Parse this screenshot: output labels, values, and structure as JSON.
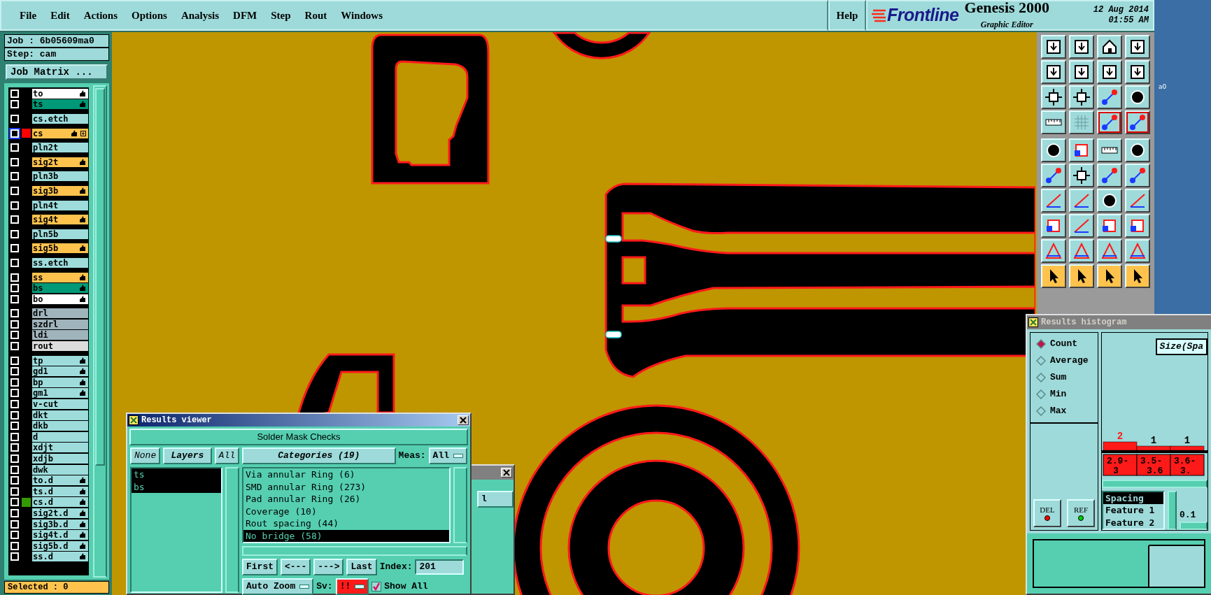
{
  "menubar": {
    "items": [
      {
        "label": "File"
      },
      {
        "label": "Edit"
      },
      {
        "label": "Actions"
      },
      {
        "label": "Options"
      },
      {
        "label": "Analysis"
      },
      {
        "label": "DFM"
      },
      {
        "label": "Step"
      },
      {
        "label": "Rout"
      },
      {
        "label": "Windows"
      }
    ],
    "help": "Help"
  },
  "branding": {
    "logo": "Frontline",
    "product": "Genesis 2000",
    "subtitle": "Graphic Editor",
    "date": "12 Aug 2014",
    "time": "01:55 AM"
  },
  "desktop": {
    "label": "a0"
  },
  "job_panel": {
    "job": "Job : 6b05609ma0",
    "step": "Step: cam",
    "matrix_button": "Job Matrix ...",
    "status": "Selected : 0",
    "layer_groups": [
      {
        "layers": [
          {
            "name": "to",
            "color": "#ffffff",
            "hand": true,
            "checked": false,
            "active": false
          },
          {
            "name": "ts",
            "color": "#009977",
            "hand": true,
            "checked": false,
            "active": false
          }
        ]
      },
      {
        "layers": [
          {
            "name": "cs.etch",
            "color": "#9edcdc",
            "hand": false,
            "checked": false,
            "active": false
          }
        ]
      },
      {
        "layers": [
          {
            "name": "cs",
            "color": "#ffc34d",
            "hand": true,
            "checked": false,
            "active": true,
            "swatch": {
              "color": "#ff0000"
            },
            "marker": true
          }
        ]
      },
      {
        "layers": [
          {
            "name": "pln2t",
            "color": "#9edcdc",
            "hand": false,
            "checked": false,
            "active": false
          }
        ]
      },
      {
        "layers": [
          {
            "name": "sig2t",
            "color": "#ffc34d",
            "hand": true,
            "checked": false,
            "active": false
          }
        ]
      },
      {
        "layers": [
          {
            "name": "pln3b",
            "color": "#9edcdc",
            "hand": false,
            "checked": false,
            "active": false
          }
        ]
      },
      {
        "layers": [
          {
            "name": "sig3b",
            "color": "#ffc34d",
            "hand": true,
            "checked": false,
            "active": false
          }
        ]
      },
      {
        "layers": [
          {
            "name": "pln4t",
            "color": "#9edcdc",
            "hand": false,
            "checked": false,
            "active": false
          }
        ]
      },
      {
        "layers": [
          {
            "name": "sig4t",
            "color": "#ffc34d",
            "hand": true,
            "checked": false,
            "active": false
          }
        ]
      },
      {
        "layers": [
          {
            "name": "pln5b",
            "color": "#9edcdc",
            "hand": false,
            "checked": false,
            "active": false
          }
        ]
      },
      {
        "layers": [
          {
            "name": "sig5b",
            "color": "#ffc34d",
            "hand": true,
            "checked": false,
            "active": false
          }
        ]
      },
      {
        "layers": [
          {
            "name": "ss.etch",
            "color": "#9edcdc",
            "hand": false,
            "checked": false,
            "active": false
          }
        ]
      },
      {
        "layers": [
          {
            "name": "ss",
            "color": "#ffc34d",
            "hand": true,
            "checked": false,
            "active": false
          },
          {
            "name": "bs",
            "color": "#009977",
            "hand": true,
            "checked": false,
            "active": false
          },
          {
            "name": "bo",
            "color": "#ffffff",
            "hand": true,
            "checked": false,
            "active": false
          }
        ]
      },
      {
        "layers": [
          {
            "name": "drl",
            "color": "#a0b4bc",
            "hand": false,
            "checked": false,
            "active": false
          },
          {
            "name": "szdrl",
            "color": "#a0b4bc",
            "hand": false,
            "checked": false,
            "active": false
          },
          {
            "name": "ldi",
            "color": "#a0b4bc",
            "hand": false,
            "checked": false,
            "active": false
          },
          {
            "name": "rout",
            "color": "#dcdcdc",
            "hand": false,
            "checked": false,
            "active": false
          }
        ]
      },
      {
        "layers": [
          {
            "name": "tp",
            "color": "#9edcdc",
            "hand": true,
            "checked": false,
            "active": false
          },
          {
            "name": "gd1",
            "color": "#9edcdc",
            "hand": true,
            "checked": false,
            "active": false
          },
          {
            "name": "bp",
            "color": "#9edcdc",
            "hand": true,
            "checked": false,
            "active": false
          },
          {
            "name": "gm1",
            "color": "#9edcdc",
            "hand": true,
            "checked": false,
            "active": false
          },
          {
            "name": "v-cut",
            "color": "#9edcdc",
            "hand": false,
            "checked": false,
            "active": false
          },
          {
            "name": "dkt",
            "color": "#9edcdc",
            "hand": false,
            "checked": false,
            "active": false
          },
          {
            "name": "dkb",
            "color": "#9edcdc",
            "hand": false,
            "checked": false,
            "active": false
          },
          {
            "name": "d",
            "color": "#9edcdc",
            "hand": false,
            "checked": false,
            "active": false
          },
          {
            "name": "xdjt",
            "color": "#9edcdc",
            "hand": false,
            "checked": false,
            "active": false
          },
          {
            "name": "xdjb",
            "color": "#9edcdc",
            "hand": false,
            "checked": false,
            "active": false
          },
          {
            "name": "dwk",
            "color": "#9edcdc",
            "hand": false,
            "checked": false,
            "active": false
          },
          {
            "name": "to.d",
            "color": "#9edcdc",
            "hand": true,
            "checked": false,
            "active": false
          },
          {
            "name": "ts.d",
            "color": "#9edcdc",
            "hand": true,
            "checked": false,
            "active": false
          },
          {
            "name": "cs.d",
            "color": "#9edcdc",
            "hand": true,
            "checked": false,
            "active": false,
            "swatch": {
              "color": "#339900"
            }
          },
          {
            "name": "sig2t.d",
            "color": "#9edcdc",
            "hand": true,
            "checked": false,
            "active": false
          },
          {
            "name": "sig3b.d",
            "color": "#9edcdc",
            "hand": true,
            "checked": false,
            "active": false
          },
          {
            "name": "sig4t.d",
            "color": "#9edcdc",
            "hand": true,
            "checked": false,
            "active": false
          },
          {
            "name": "sig5b.d",
            "color": "#9edcdc",
            "hand": true,
            "checked": false,
            "active": false
          },
          {
            "name": "ss.d",
            "color": "#9edcdc",
            "hand": true,
            "checked": false,
            "active": false
          }
        ]
      }
    ]
  },
  "results_viewer": {
    "title": "Results viewer",
    "heading": "Solder Mask Checks",
    "layer_buttons": [
      "None",
      "Layers",
      "All"
    ],
    "layers": [
      {
        "name": "ts",
        "selected": true
      },
      {
        "name": "bs",
        "selected": true
      }
    ],
    "categories_button": "Categories (19)",
    "meas_label": "Meas:",
    "meas_value": "All",
    "categories": [
      {
        "label": "Via annular Ring (6)",
        "selected": false
      },
      {
        "label": "SMD annular Ring (273)",
        "selected": false
      },
      {
        "label": "Pad annular Ring (26)",
        "selected": false
      },
      {
        "label": "Coverage (10)",
        "selected": false
      },
      {
        "label": "Rout spacing (44)",
        "selected": false
      },
      {
        "label": "No bridge (58)",
        "selected": true
      }
    ],
    "nav_buttons": [
      "First",
      "<---",
      "--->",
      "Last"
    ],
    "index_label": "Index:",
    "index_value": "201",
    "zoom_dropdown": "Auto Zoom",
    "severity_label": "Sv:",
    "severity_value": "!!",
    "show_all": {
      "label": "Show All",
      "checked": true
    }
  },
  "background_window": {
    "dropdown": "l"
  },
  "histogram": {
    "title": "Results histogram",
    "modes": [
      {
        "label": "Count",
        "selected": true
      },
      {
        "label": "Average",
        "selected": false
      },
      {
        "label": "Sum",
        "selected": false
      },
      {
        "label": "Min",
        "selected": false
      },
      {
        "label": "Max",
        "selected": false
      }
    ],
    "buttons": [
      {
        "label": "DEL",
        "color": "#ff0000"
      },
      {
        "label": "REF",
        "color": "#00cc00"
      }
    ],
    "chart": {
      "chart_data": {
        "type": "bar",
        "title": "Size(Spa",
        "categories": [
          "2.9-3",
          "3.5-3.6",
          "3.6-3."
        ],
        "values": [
          2,
          1,
          1
        ],
        "data_labels": true
      }
    },
    "measures": [
      {
        "label": "Spacing",
        "selected": true
      },
      {
        "label": "Feature 1",
        "selected": false
      },
      {
        "label": "Feature 2",
        "selected": false
      }
    ],
    "step_value": "0.1"
  }
}
